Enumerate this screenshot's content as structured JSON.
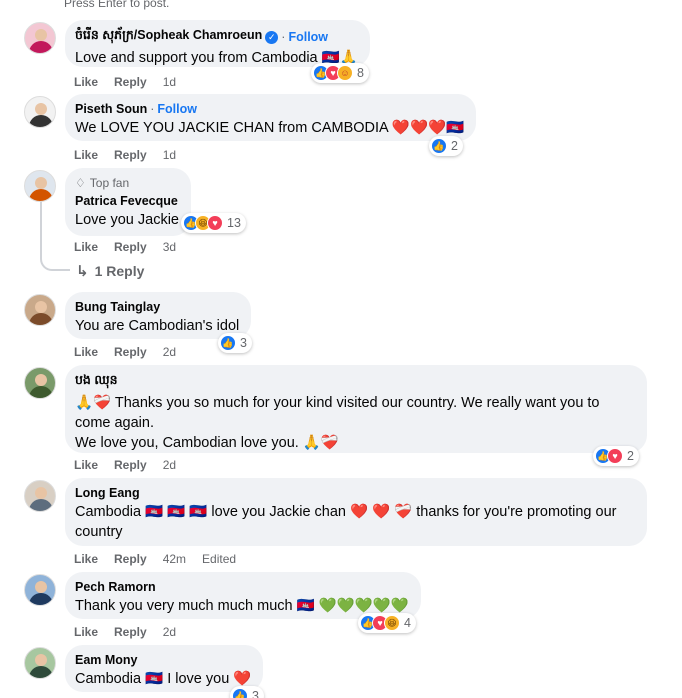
{
  "hint": "Press Enter to post.",
  "comments": [
    {
      "author": "ចំរើន សុភ័ក្រ/Sopheak Chamroeun",
      "follow": "Follow",
      "text": "Love and support you from Cambodia 🇰🇭🙏",
      "like": "Like",
      "reply": "Reply",
      "time": "1d",
      "reaction_count": "8"
    },
    {
      "author": "Piseth Soun",
      "follow": "Follow",
      "text": "We LOVE YOU JACKIE CHAN from CAMBODIA ❤️❤️❤️🇰🇭",
      "like": "Like",
      "reply": "Reply",
      "time": "1d",
      "reaction_count": "2"
    },
    {
      "badge": "Top fan",
      "author": "Patrica Fevecque",
      "text": "Love you Jackie",
      "like": "Like",
      "reply": "Reply",
      "time": "3d",
      "reaction_count": "13",
      "replies": "1 Reply"
    },
    {
      "author": "Bung Tainglay",
      "text": "You are Cambodian's idol",
      "like": "Like",
      "reply": "Reply",
      "time": "2d",
      "reaction_count": "3"
    },
    {
      "author": "បង ឈុន",
      "text_line1": "🙏❤️‍🩹 Thanks you so much for your kind visited our country. We really want you to",
      "text_line2": "come again.",
      "text_line3": "We love you, Cambodian love you. 🙏❤️‍🩹",
      "like": "Like",
      "reply": "Reply",
      "time": "2d",
      "reaction_count": "2"
    },
    {
      "author": "Long Eang",
      "text_line1": "Cambodia 🇰🇭 🇰🇭 🇰🇭 love you Jackie chan ❤️ ❤️ ❤️‍🩹 thanks for you're promoting our",
      "text_line2": "country",
      "like": "Like",
      "reply": "Reply",
      "time": "42m",
      "edited": "Edited"
    },
    {
      "author": "Pech Ramorn",
      "text": "Thank you very much much much 🇰🇭 💚💚💚💚💚",
      "like": "Like",
      "reply": "Reply",
      "time": "2d",
      "reaction_count": "4"
    },
    {
      "author": "Eam Mony",
      "text": "Cambodia 🇰🇭 I love you ❤️",
      "reaction_count": "3"
    }
  ],
  "colors": {
    "accent": "#1877f2",
    "bubble": "#f0f2f5",
    "muted": "#65676b"
  },
  "icons": [
    "verified-icon",
    "diamond-icon",
    "reply-arrow-icon",
    "like-reaction-icon",
    "love-reaction-icon",
    "haha-reaction-icon",
    "care-reaction-icon"
  ]
}
